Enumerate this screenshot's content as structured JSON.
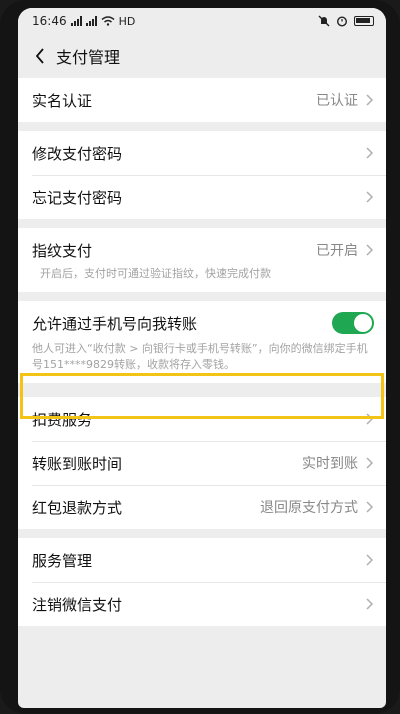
{
  "status_bar": {
    "time": "16:46",
    "network": "HD"
  },
  "nav": {
    "title": "支付管理"
  },
  "groups": {
    "identity": {
      "label": "实名认证",
      "value": "已认证"
    },
    "password": {
      "change_label": "修改支付密码",
      "forgot_label": "忘记支付密码"
    },
    "fingerprint": {
      "label": "指纹支付",
      "value": "已开启",
      "desc": "开启后，支付时可通过验证指纹，快速完成付款"
    },
    "phone_transfer": {
      "label": "允许通过手机号向我转账",
      "toggle_on": true,
      "desc": "他人可进入“收付款 > 向银行卡或手机号转账”，向你的微信绑定手机号151****9829转账，收款将存入零钱。"
    },
    "services": {
      "deduction_label": "扣费服务",
      "transfer_time_label": "转账到账时间",
      "transfer_time_value": "实时到账",
      "refund_label": "红包退款方式",
      "refund_value": "退回原支付方式"
    },
    "management": {
      "service_mgmt_label": "服务管理",
      "cancel_label": "注销微信支付"
    }
  },
  "colors": {
    "accent_green": "#1fa851",
    "highlight": "#f3c316"
  }
}
